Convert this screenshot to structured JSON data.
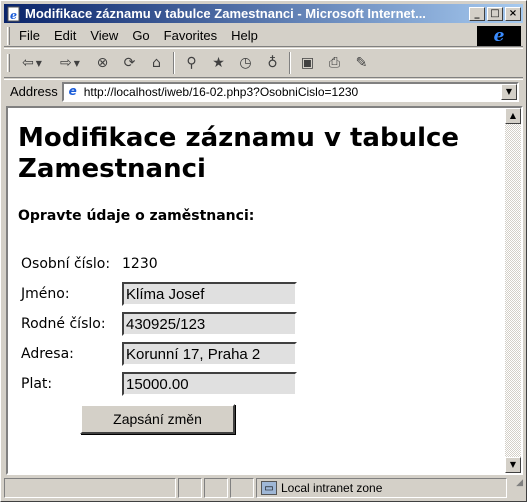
{
  "window": {
    "title": "Modifikace záznamu v tabulce Zamestnanci - Microsoft Internet...",
    "minimize": "_",
    "maximize": "□",
    "close": "×"
  },
  "menu": {
    "items": [
      "File",
      "Edit",
      "View",
      "Go",
      "Favorites",
      "Help"
    ]
  },
  "toolbar": {
    "icons": [
      "back-icon",
      "forward-icon",
      "stop-icon",
      "refresh-icon",
      "home-icon",
      "search-icon",
      "favorites-icon",
      "history-icon",
      "channels-icon",
      "fullscreen-icon",
      "print-icon",
      "edit-icon"
    ]
  },
  "address": {
    "label": "Address",
    "url": "http://localhost/iweb/16-02.php3?OsobniCislo=1230"
  },
  "page": {
    "heading": "Modifikace záznamu v tabulce Zamestnanci",
    "subtitle": "Opravte údaje o zaměstnanci:",
    "fields": [
      {
        "label": "Osobní číslo:",
        "value": "1230"
      },
      {
        "label": "Jméno:",
        "value": "Klíma Josef"
      },
      {
        "label": "Rodné číslo:",
        "value": "430925/123"
      },
      {
        "label": "Adresa:",
        "value": "Korunní 17, Praha 2"
      },
      {
        "label": "Plat:",
        "value": "15000.00"
      }
    ],
    "submit_label": "Zapsání změn"
  },
  "status": {
    "zone": "Local intranet zone"
  },
  "colors": {
    "title_gradient_start": "#0a246a",
    "title_gradient_end": "#a6caf0",
    "chrome": "#d4d0c8",
    "field_bg": "#e0e0e0"
  }
}
